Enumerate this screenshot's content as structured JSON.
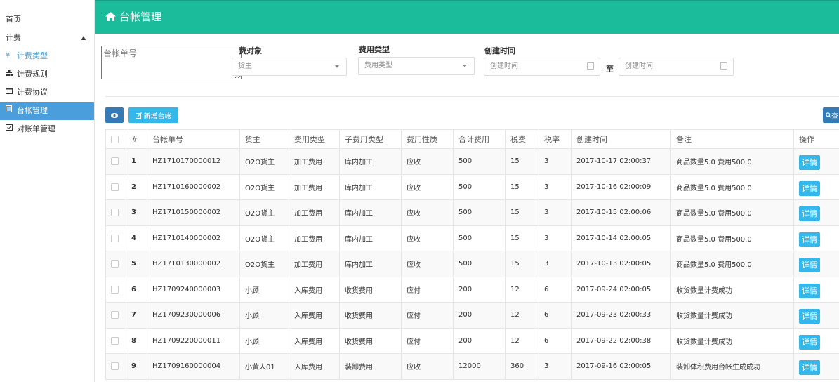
{
  "sidebar": {
    "home": "首页",
    "group": "计费",
    "items": [
      {
        "label": "计费类型",
        "icon": "yen-icon"
      },
      {
        "label": "计费规则",
        "icon": "sitemap-icon"
      },
      {
        "label": "计费协议",
        "icon": "calendar-icon"
      },
      {
        "label": "台帐管理",
        "icon": "list-icon"
      },
      {
        "label": "对账单管理",
        "icon": "calendar-check-icon"
      }
    ]
  },
  "header": {
    "title": "台帐管理"
  },
  "filters": {
    "ledger_no_placeholder": "台帐单号",
    "object_label": "费对象",
    "object_value": "货主",
    "fee_type_label": "费用类型",
    "fee_type_value": "费用类型",
    "created_label": "创建时间",
    "start_placeholder": "创建时间",
    "to_label": "至",
    "end_placeholder": "创建时间"
  },
  "actions": {
    "add_label": "新增台帐",
    "query_label": "查"
  },
  "table": {
    "headers": [
      "#",
      "台帐单号",
      "货主",
      "费用类型",
      "子费用类型",
      "费用性质",
      "合计费用",
      "税费",
      "税率",
      "创建时间",
      "备注",
      "操作"
    ],
    "detail_label": "详情",
    "rows": [
      {
        "n": "1",
        "no": "HZ1710170000012",
        "owner": "O2O货主",
        "type": "加工费用",
        "sub": "库内加工",
        "nature": "应收",
        "total": "500",
        "tax": "15",
        "rate": "3",
        "time": "2017-10-17 02:00:37",
        "note": "商品数量5.0 费用500.0"
      },
      {
        "n": "2",
        "no": "HZ1710160000002",
        "owner": "O2O货主",
        "type": "加工费用",
        "sub": "库内加工",
        "nature": "应收",
        "total": "500",
        "tax": "15",
        "rate": "3",
        "time": "2017-10-16 02:00:09",
        "note": "商品数量5.0 费用500.0"
      },
      {
        "n": "3",
        "no": "HZ1710150000002",
        "owner": "O2O货主",
        "type": "加工费用",
        "sub": "库内加工",
        "nature": "应收",
        "total": "500",
        "tax": "15",
        "rate": "3",
        "time": "2017-10-15 02:00:06",
        "note": "商品数量5.0 费用500.0"
      },
      {
        "n": "4",
        "no": "HZ1710140000002",
        "owner": "O2O货主",
        "type": "加工费用",
        "sub": "库内加工",
        "nature": "应收",
        "total": "500",
        "tax": "15",
        "rate": "3",
        "time": "2017-10-14 02:00:05",
        "note": "商品数量5.0 费用500.0"
      },
      {
        "n": "5",
        "no": "HZ1710130000002",
        "owner": "O2O货主",
        "type": "加工费用",
        "sub": "库内加工",
        "nature": "应收",
        "total": "500",
        "tax": "15",
        "rate": "3",
        "time": "2017-10-13 02:00:05",
        "note": "商品数量5.0 费用500.0"
      },
      {
        "n": "6",
        "no": "HZ1709240000003",
        "owner": "小顾",
        "type": "入库费用",
        "sub": "收货费用",
        "nature": "应付",
        "total": "200",
        "tax": "12",
        "rate": "6",
        "time": "2017-09-24 02:00:05",
        "note": "收货数量计费成功"
      },
      {
        "n": "7",
        "no": "HZ1709230000006",
        "owner": "小顾",
        "type": "入库费用",
        "sub": "收货费用",
        "nature": "应付",
        "total": "200",
        "tax": "12",
        "rate": "6",
        "time": "2017-09-23 02:00:33",
        "note": "收货数量计费成功"
      },
      {
        "n": "8",
        "no": "HZ1709220000011",
        "owner": "小顾",
        "type": "入库费用",
        "sub": "收货费用",
        "nature": "应付",
        "total": "200",
        "tax": "12",
        "rate": "6",
        "time": "2017-09-22 02:00:38",
        "note": "收货数量计费成功"
      },
      {
        "n": "9",
        "no": "HZ1709160000004",
        "owner": "小黄人01",
        "type": "入库费用",
        "sub": "装卸费用",
        "nature": "应收",
        "total": "12000",
        "tax": "360",
        "rate": "3",
        "time": "2017-09-16 02:00:05",
        "note": "装卸体积费用台帐生成成功"
      }
    ]
  }
}
